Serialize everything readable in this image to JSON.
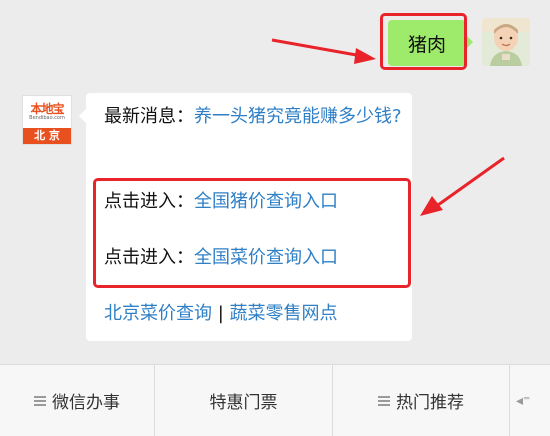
{
  "outgoing": {
    "text": "猪肉"
  },
  "bot": {
    "logo_text": "本地宝",
    "logo_url": "Bendibao.com",
    "logo_city": "北 京"
  },
  "incoming": {
    "news_label": "最新消息：",
    "news_link": "养一头猪究竟能赚多少钱?",
    "enter1_label": "点击进入：",
    "enter1_link": "全国猪价查询入口",
    "enter2_label": "点击进入：",
    "enter2_link": "全国菜价查询入口",
    "bottom_link1": "北京菜价查询",
    "separator": " | ",
    "bottom_link2": "蔬菜零售网点"
  },
  "menu": {
    "items": [
      "微信办事",
      "特惠门票",
      "热门推荐"
    ]
  },
  "colors": {
    "highlight": "#e8232a",
    "bubble_out": "#9eea6a",
    "link": "#2e7fc6",
    "brand": "#e8501f"
  }
}
